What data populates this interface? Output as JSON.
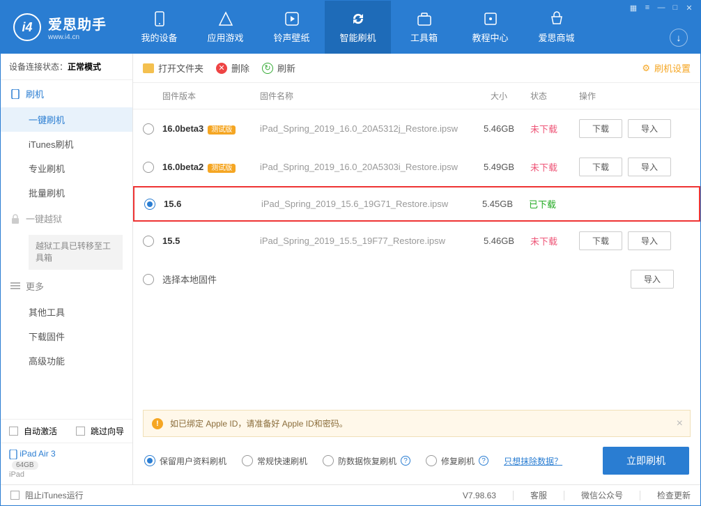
{
  "app": {
    "name": "爱思助手",
    "url": "www.i4.cn"
  },
  "tabs": [
    "我的设备",
    "应用游戏",
    "铃声壁纸",
    "智能刷机",
    "工具箱",
    "教程中心",
    "爱思商城"
  ],
  "tabs_active": 3,
  "conn": {
    "label": "设备连接状态：",
    "value": "正常模式"
  },
  "nav": {
    "flash": "刷机",
    "items": [
      "一键刷机",
      "iTunes刷机",
      "专业刷机",
      "批量刷机"
    ],
    "jailbreak": "一键越狱",
    "jb_note": "越狱工具已转移至工具箱",
    "more": "更多",
    "more_items": [
      "其他工具",
      "下载固件",
      "高级功能"
    ]
  },
  "sidebar_bottom": {
    "auto_activate": "自动激活",
    "skip_guide": "跳过向导",
    "device_name": "iPad Air 3",
    "device_cap": "64GB",
    "device_type": "iPad"
  },
  "toolbar": {
    "open": "打开文件夹",
    "delete": "删除",
    "refresh": "刷新",
    "settings": "刷机设置"
  },
  "columns": {
    "ver": "固件版本",
    "name": "固件名称",
    "size": "大小",
    "status": "状态",
    "op": "操作"
  },
  "rows": [
    {
      "ver": "16.0beta3",
      "beta": "测试版",
      "name": "iPad_Spring_2019_16.0_20A5312j_Restore.ipsw",
      "size": "5.46GB",
      "status": "未下载",
      "sel": false,
      "ops": [
        "下载",
        "导入"
      ]
    },
    {
      "ver": "16.0beta2",
      "beta": "测试版",
      "name": "iPad_Spring_2019_16.0_20A5303i_Restore.ipsw",
      "size": "5.49GB",
      "status": "未下载",
      "sel": false,
      "ops": [
        "下载",
        "导入"
      ]
    },
    {
      "ver": "15.6",
      "beta": "",
      "name": "iPad_Spring_2019_15.6_19G71_Restore.ipsw",
      "size": "5.45GB",
      "status": "已下载",
      "sel": true,
      "hl": true,
      "ops": []
    },
    {
      "ver": "15.5",
      "beta": "",
      "name": "iPad_Spring_2019_15.5_19F77_Restore.ipsw",
      "size": "5.46GB",
      "status": "未下载",
      "sel": false,
      "ops": [
        "下载",
        "导入"
      ]
    }
  ],
  "local_row": {
    "label": "选择本地固件",
    "op": "导入"
  },
  "warn": "如已绑定 Apple ID，请准备好 Apple ID和密码。",
  "opts": {
    "keep": "保留用户资料刷机",
    "fast": "常规快速刷机",
    "anti": "防数据恢复刷机",
    "repair": "修复刷机",
    "erase_link": "只想抹除数据？",
    "flash": "立即刷机"
  },
  "footer": {
    "block": "阻止iTunes运行",
    "ver": "V7.98.63",
    "svc": "客服",
    "wechat": "微信公众号",
    "update": "检查更新"
  }
}
